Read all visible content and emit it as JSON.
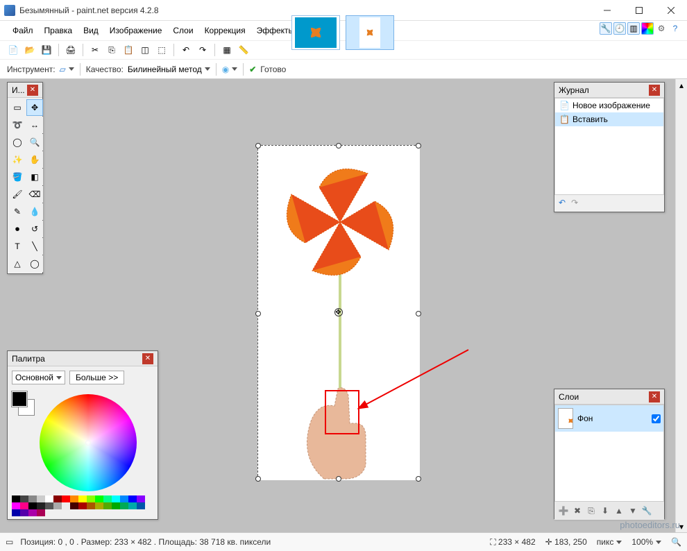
{
  "title": "Безымянный - paint.net версия 4.2.8",
  "menu": [
    "Файл",
    "Правка",
    "Вид",
    "Изображение",
    "Слои",
    "Коррекция",
    "Эффекты"
  ],
  "toolbar2": {
    "tool_label": "Инструмент:",
    "quality_label": "Качество:",
    "quality_value": "Билинейный метод",
    "ready": "Готово"
  },
  "tools_title": "И...",
  "history": {
    "title": "Журнал",
    "items": [
      "Новое изображение",
      "Вставить"
    ]
  },
  "colors": {
    "title": "Палитра",
    "primary_label": "Основной",
    "more": "Больше >>"
  },
  "layers": {
    "title": "Слои",
    "bg": "Фон"
  },
  "status": {
    "pos": "Позиция: 0 , 0 . Размер: 233  × 482 . Площадь: 38 718 кв. пиксели",
    "dims": "233 × 482",
    "cursor": "183, 250",
    "unit": "пикс",
    "zoom": "100%"
  },
  "watermark": "photoeditors.ru"
}
